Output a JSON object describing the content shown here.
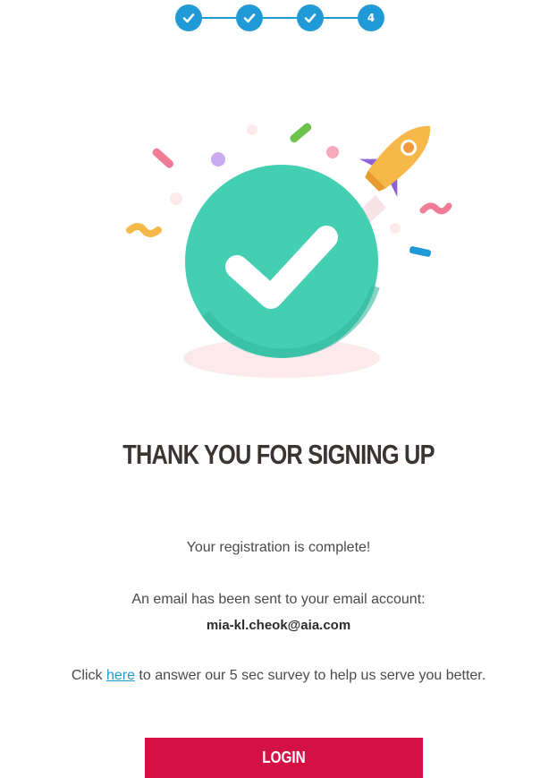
{
  "stepper": {
    "steps": [
      {
        "state": "complete",
        "icon": "check-icon"
      },
      {
        "state": "complete",
        "icon": "check-icon"
      },
      {
        "state": "complete",
        "icon": "check-icon"
      },
      {
        "state": "current",
        "label": "4"
      }
    ],
    "color": "#1f9ad6"
  },
  "illustration": {
    "icons": [
      "success-check-icon",
      "rocket-icon",
      "confetti-icon"
    ],
    "colors": {
      "circle": "#44cfb3",
      "rocket": "#f7b84a",
      "fin": "#8c63d9"
    }
  },
  "title": "THANK YOU FOR SIGNING UP",
  "message": {
    "registration": "Your registration is complete!",
    "email_sent": "An email has been sent to your email account:",
    "email_address": "mia-kl.cheok@aia.com"
  },
  "survey": {
    "prefix": "Click",
    "link_text": "here",
    "suffix": "to answer our 5 sec survey to help us serve you better."
  },
  "login": {
    "label": "LOGIN",
    "color": "#d31145"
  }
}
